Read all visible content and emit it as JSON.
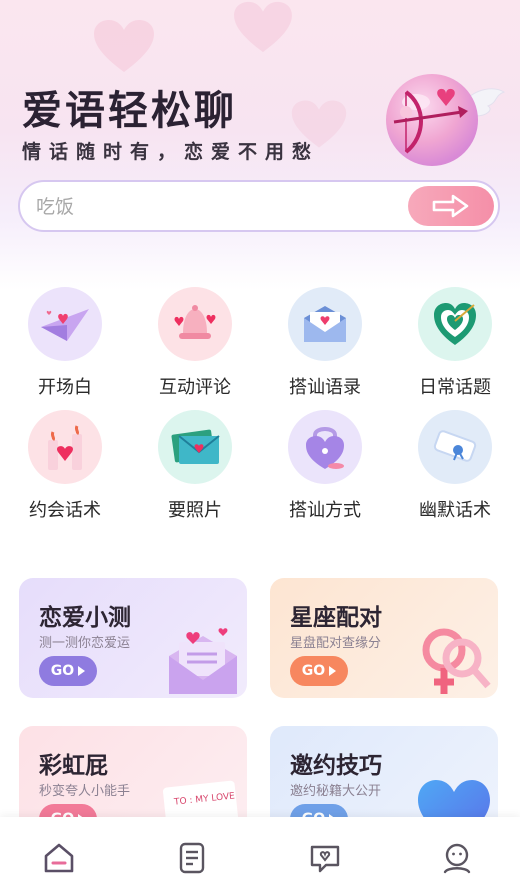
{
  "header": {
    "title": "爱语轻松聊",
    "subtitle": "情话随时有，恋爱不用愁",
    "mascot_icon": "cupid-bow-heart-icon"
  },
  "search": {
    "value": "",
    "placeholder": "吃饭",
    "submit_icon": "arrow-right-icon"
  },
  "categories": [
    {
      "label": "开场白",
      "icon": "paper-plane-heart-icon"
    },
    {
      "label": "互动评论",
      "icon": "heart-bell-icon"
    },
    {
      "label": "搭讪语录",
      "icon": "heart-envelope-icon"
    },
    {
      "label": "日常话题",
      "icon": "heart-target-icon"
    },
    {
      "label": "约会话术",
      "icon": "candles-heart-icon"
    },
    {
      "label": "要照片",
      "icon": "love-letter-icon"
    },
    {
      "label": "搭讪方式",
      "icon": "love-lock-icon"
    },
    {
      "label": "幽默话术",
      "icon": "scroll-letter-icon"
    }
  ],
  "cards": [
    {
      "title": "恋爱小测",
      "subtitle": "测一测你恋爱运",
      "go": "GO",
      "icon": "heart-envelope-icon",
      "color": "#8f7be0"
    },
    {
      "title": "星座配对",
      "subtitle": "星盘配对查缘分",
      "go": "GO",
      "icon": "gender-symbols-icon",
      "color": "#f7875f"
    },
    {
      "title": "彩虹屁",
      "subtitle": "秒变夸人小能手",
      "go": "GO",
      "icon": "love-card-icon",
      "card_text": "TO : MY LOVE",
      "color": "#f27a98"
    },
    {
      "title": "邀约技巧",
      "subtitle": "邀约秘籍大公开",
      "go": "GO",
      "icon": "blue-heart-icon",
      "color": "#6fa0e8"
    }
  ],
  "tabbar": [
    {
      "name": "home",
      "icon": "home-icon",
      "active": true
    },
    {
      "name": "notes",
      "icon": "note-icon",
      "active": false
    },
    {
      "name": "chat",
      "icon": "heart-chat-icon",
      "active": false
    },
    {
      "name": "profile",
      "icon": "profile-icon",
      "active": false
    }
  ],
  "colors": {
    "accent_pink": "#f58fa8",
    "active_tab": "#e86c9a",
    "inactive_tab": "#5a5560"
  }
}
